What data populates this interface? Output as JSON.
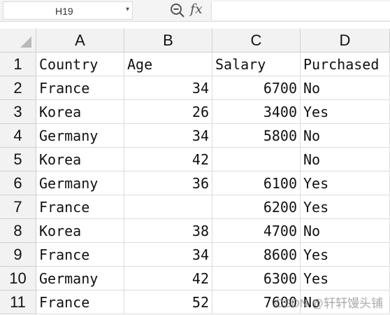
{
  "formula_bar": {
    "cell_reference": "H19",
    "function_label": "fx",
    "formula_value": ""
  },
  "sheet": {
    "columns": [
      "A",
      "B",
      "C",
      "D"
    ],
    "rows": [
      {
        "row": "1",
        "cells": [
          "Country",
          "Age",
          "Salary",
          "Purchased"
        ]
      },
      {
        "row": "2",
        "cells": [
          "France",
          "34",
          "6700",
          "No"
        ]
      },
      {
        "row": "3",
        "cells": [
          "Korea",
          "26",
          "3400",
          "Yes"
        ]
      },
      {
        "row": "4",
        "cells": [
          "Germany",
          "34",
          "5800",
          "No"
        ]
      },
      {
        "row": "5",
        "cells": [
          "Korea",
          "42",
          "",
          "No"
        ]
      },
      {
        "row": "6",
        "cells": [
          "Germany",
          "36",
          "6100",
          "Yes"
        ]
      },
      {
        "row": "7",
        "cells": [
          "France",
          "",
          "6200",
          "Yes"
        ]
      },
      {
        "row": "8",
        "cells": [
          "Korea",
          "38",
          "4700",
          "No"
        ]
      },
      {
        "row": "9",
        "cells": [
          "France",
          "34",
          "8600",
          "Yes"
        ]
      },
      {
        "row": "10",
        "cells": [
          "Germany",
          "42",
          "6300",
          "Yes"
        ]
      },
      {
        "row": "11",
        "cells": [
          "France",
          "52",
          "7600",
          "No"
        ]
      }
    ]
  },
  "watermark": "CSDN @轩轩馒头铺",
  "colors": {
    "header_background": "#f2f2f2",
    "gridline": "#dcdcdc",
    "text": "#111111"
  }
}
